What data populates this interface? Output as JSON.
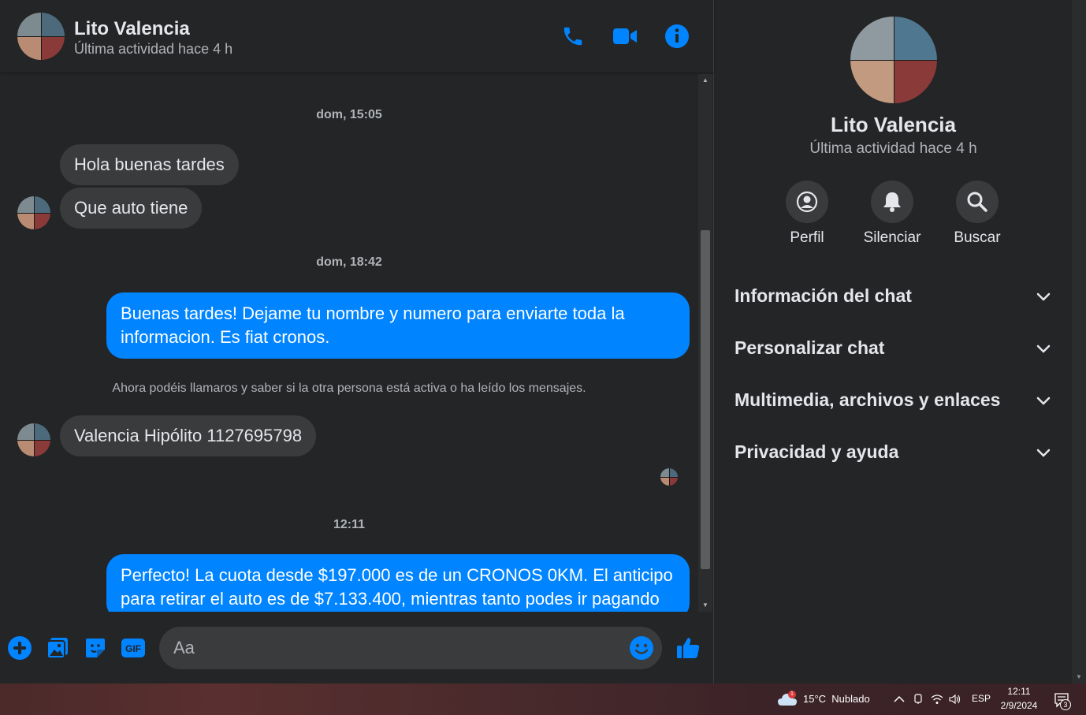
{
  "header": {
    "name": "Lito Valencia",
    "status": "Última actividad hace 4 h",
    "icons": [
      "phone-icon",
      "video-camera-icon",
      "info-icon"
    ],
    "accent": "#0084ff"
  },
  "messages": {
    "ts1": "dom, 15:05",
    "m1": "Hola buenas tardes",
    "m2": "Que auto tiene",
    "ts2": "dom, 18:42",
    "m3": "Buenas tardes! Dejame tu nombre y numero para enviarte toda la informacion. Es fiat cronos.",
    "system": "Ahora podéis llamaros y saber si la otra persona está activa o ha leído los mensajes.",
    "m4": "Valencia Hipólito 1127695798",
    "ts3": "12:11",
    "m5": "Perfecto! La cuota desde $197.000 es de un CRONOS 0KM. El anticipo para retirar el auto es de $7.133.400, mientras tanto podes ir pagando"
  },
  "composer": {
    "placeholder": "Aa",
    "icons": [
      "plus-icon",
      "gallery-icon",
      "sticker-icon",
      "gif-icon",
      "emoji-icon",
      "like-icon"
    ],
    "gif_label": "GIF"
  },
  "panel": {
    "name": "Lito Valencia",
    "status": "Última actividad hace 4 h",
    "actions": [
      {
        "label": "Perfil",
        "icon": "profile-icon"
      },
      {
        "label": "Silenciar",
        "icon": "bell-icon"
      },
      {
        "label": "Buscar",
        "icon": "search-icon"
      }
    ],
    "sections": [
      "Información del chat",
      "Personalizar chat",
      "Multimedia, archivos y enlaces",
      "Privacidad y ayuda"
    ]
  },
  "taskbar": {
    "weather": "15°C  Nublado",
    "weather_badge": "1",
    "language": "ESP",
    "time": "12:11",
    "date": "2/9/2024",
    "notifications": "3"
  }
}
